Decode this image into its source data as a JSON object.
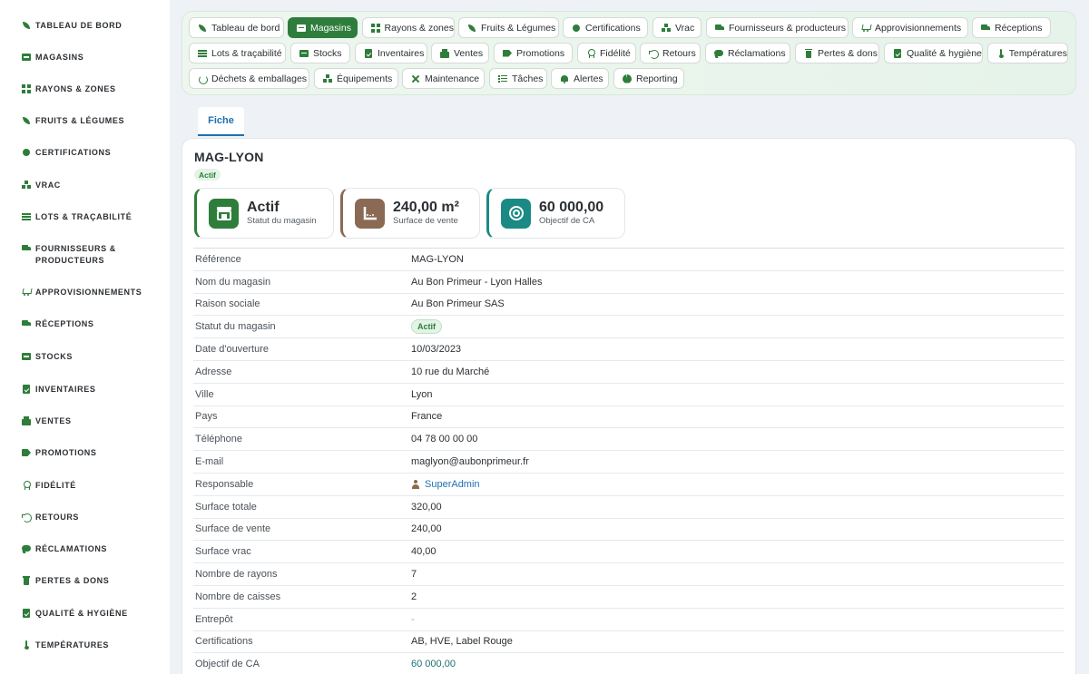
{
  "sidebar": {
    "items": [
      {
        "label": "TABLEAU DE BORD",
        "icon": "leaf-icon"
      },
      {
        "label": "MAGASINS",
        "icon": "store-icon"
      },
      {
        "label": "RAYONS & ZONES",
        "icon": "grid-icon"
      },
      {
        "label": "FRUITS & LÉGUMES",
        "icon": "leaf-icon"
      },
      {
        "label": "CERTIFICATIONS",
        "icon": "certificate-icon"
      },
      {
        "label": "VRAC",
        "icon": "boxes-icon"
      },
      {
        "label": "LOTS & TRAÇABILITÉ",
        "icon": "barcode-icon"
      },
      {
        "label": "FOURNISSEURS & PRODUCTEURS",
        "icon": "tractor-icon"
      },
      {
        "label": "APPROVISIONNEMENTS",
        "icon": "cart-icon"
      },
      {
        "label": "RÉCEPTIONS",
        "icon": "truck-icon"
      },
      {
        "label": "STOCKS",
        "icon": "warehouse-icon"
      },
      {
        "label": "INVENTAIRES",
        "icon": "clipboard-check-icon"
      },
      {
        "label": "VENTES",
        "icon": "cash-register-icon"
      },
      {
        "label": "PROMOTIONS",
        "icon": "tag-icon"
      },
      {
        "label": "FIDÉLITÉ",
        "icon": "award-icon"
      },
      {
        "label": "RETOURS",
        "icon": "undo-icon"
      },
      {
        "label": "RÉCLAMATIONS",
        "icon": "chat-icon"
      },
      {
        "label": "PERTES & DONS",
        "icon": "trash-icon"
      },
      {
        "label": "QUALITÉ & HYGIÈNE",
        "icon": "clipboard-icon"
      },
      {
        "label": "TEMPÉRATURES",
        "icon": "thermometer-icon"
      }
    ]
  },
  "topnav": {
    "chips": [
      {
        "label": "Tableau de bord",
        "icon": "leaf-icon"
      },
      {
        "label": "Magasins",
        "icon": "store-icon",
        "active": true
      },
      {
        "label": "Rayons & zones",
        "icon": "grid-icon"
      },
      {
        "label": "Fruits & Légumes",
        "icon": "leaf-icon"
      },
      {
        "label": "Certifications",
        "icon": "certificate-icon"
      },
      {
        "label": "Vrac",
        "icon": "boxes-icon"
      },
      {
        "label": "Fournisseurs & producteurs",
        "icon": "tractor-icon"
      },
      {
        "label": "Approvisionnements",
        "icon": "cart-icon"
      },
      {
        "label": "Réceptions",
        "icon": "truck-icon"
      },
      {
        "label": "Lots & traçabilité",
        "icon": "barcode-icon"
      },
      {
        "label": "Stocks",
        "icon": "warehouse-icon"
      },
      {
        "label": "Inventaires",
        "icon": "clipboard-check-icon"
      },
      {
        "label": "Ventes",
        "icon": "cash-register-icon"
      },
      {
        "label": "Promotions",
        "icon": "tag-icon"
      },
      {
        "label": "Fidélité",
        "icon": "award-icon"
      },
      {
        "label": "Retours",
        "icon": "undo-icon"
      },
      {
        "label": "Réclamations",
        "icon": "chat-icon"
      },
      {
        "label": "Pertes & dons",
        "icon": "trash-icon"
      },
      {
        "label": "Qualité & hygiène",
        "icon": "clipboard-icon"
      },
      {
        "label": "Températures",
        "icon": "thermometer-icon"
      },
      {
        "label": "Déchets & emballages",
        "icon": "recycle-icon"
      },
      {
        "label": "Équipements",
        "icon": "equipment-icon"
      },
      {
        "label": "Maintenance",
        "icon": "tools-icon"
      },
      {
        "label": "Tâches",
        "icon": "tasks-icon"
      },
      {
        "label": "Alertes",
        "icon": "bell-icon"
      },
      {
        "label": "Reporting",
        "icon": "pie-chart-icon"
      }
    ]
  },
  "tabs": [
    {
      "label": "Fiche",
      "active": true
    }
  ],
  "record": {
    "title": "MAG-LYON",
    "status_badge": "Actif"
  },
  "kpis": [
    {
      "value": "Actif",
      "label": "Statut du magasin",
      "icon": "store-icon",
      "color": "#2e7d3a"
    },
    {
      "value": "240,00 m²",
      "label": "Surface de vente",
      "icon": "ruler-icon",
      "color": "#8a6a55"
    },
    {
      "value": "60 000,00",
      "label": "Objectif de CA",
      "icon": "target-icon",
      "color": "#1b8a84"
    }
  ],
  "details": [
    {
      "label": "Référence",
      "value": "MAG-LYON"
    },
    {
      "label": "Nom du magasin",
      "value": "Au Bon Primeur - Lyon Halles"
    },
    {
      "label": "Raison sociale",
      "value": "Au Bon Primeur SAS"
    },
    {
      "label": "Statut du magasin",
      "value": "Actif"
    },
    {
      "label": "Date d'ouverture",
      "value": "10/03/2023"
    },
    {
      "label": "Adresse",
      "value": "10 rue du Marché"
    },
    {
      "label": "Ville",
      "value": "Lyon"
    },
    {
      "label": "Pays",
      "value": "France"
    },
    {
      "label": "Téléphone",
      "value": "04 78 00 00 00"
    },
    {
      "label": "E-mail",
      "value": "maglyon@aubonprimeur.fr"
    },
    {
      "label": "Responsable",
      "value": "SuperAdmin"
    },
    {
      "label": "Surface totale",
      "value": "320,00"
    },
    {
      "label": "Surface de vente",
      "value": "240,00"
    },
    {
      "label": "Surface vrac",
      "value": "40,00"
    },
    {
      "label": "Nombre de rayons",
      "value": "7"
    },
    {
      "label": "Nombre de caisses",
      "value": "2"
    },
    {
      "label": "Entrepôt",
      "value": "-"
    },
    {
      "label": "Certifications",
      "value": "AB, HVE, Label Rouge"
    },
    {
      "label": "Objectif de CA",
      "value": "60 000,00"
    }
  ],
  "colors": {
    "accent_green": "#2f7d3c",
    "link_blue": "#1f6fb2",
    "teal": "#1a6f74"
  }
}
